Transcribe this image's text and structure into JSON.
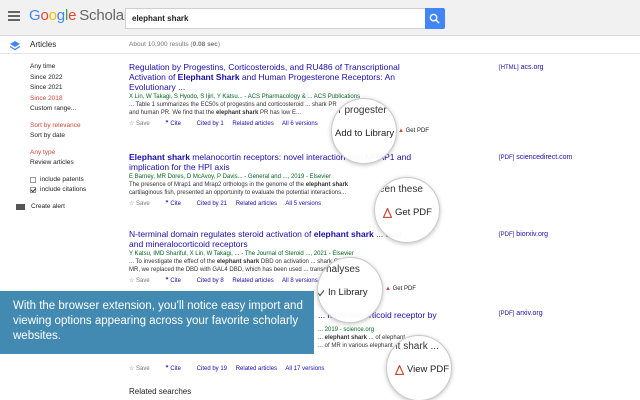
{
  "header": {
    "logo_parts": [
      "G",
      "o",
      "o",
      "g",
      "l",
      "e"
    ],
    "logo_product": "Scholar",
    "search_value": "elephant shark"
  },
  "subbar": {
    "section_label": "Articles",
    "results_prefix": "About 10,900 results (",
    "results_time": "0.08 sec",
    "results_suffix": ")"
  },
  "sidebar": {
    "time_items": [
      "Any time",
      "Since 2022",
      "Since 2021",
      "Since 2018",
      "Custom range..."
    ],
    "sort_items": [
      "Sort by relevance",
      "Sort by date"
    ],
    "type_items": [
      "Any type",
      "Review articles"
    ],
    "include_patents": "include patents",
    "include_citations": "include citations",
    "create_alert": "Create alert"
  },
  "results": [
    {
      "title_lines": [
        "Regulation by Progestins, Corticosteroids, and RU486 of Transcriptional",
        "Activation of Elephant Shark and Human Progesterone Receptors: An",
        "Evolutionary ..."
      ],
      "authors": "X Lin, W Takagi, S Hyodo, S Ijiri, Y Katsu... - ACS Pharmacology & ... ACS Publications",
      "snippet": [
        "... Table 1 summarizes the EC50s of progestins and corticosteroid ... shark PR",
        "and human PR. We find that the elephant shark PR has low E..."
      ],
      "actions": [
        "Save",
        "Cite",
        "Cited by 1",
        "Related articles",
        "All 6 versions"
      ],
      "side_format": "[HTML]",
      "side_source": "acs.org"
    },
    {
      "title_lines": [
        "Elephant shark melanocortin receptors: novel interaction with MRAP1 and",
        "implication for the HPI axis"
      ],
      "authors": "E Barney, MR Dores, D McAvoy, P Davis... - General and ..., 2019 - Elsevier",
      "snippet": [
        "The presence of Mrap1 and Mrap2 orthologs in the genome of the elephant shark",
        "cartilaginous fish, presented an opportunity to evaluate the potential interactions..."
      ],
      "actions": [
        "Save",
        "Cite",
        "Cited by 21",
        "Related articles",
        "All 5 versions"
      ],
      "side_format": "[PDF]",
      "side_source": "sciencedirect.com"
    },
    {
      "title_lines": [
        "N-terminal domain regulates steroid activation of elephant shark ... coid",
        "and mineralocorticoid receptors"
      ],
      "authors": "Y Katsu, IMD Shariful, X Lin, W Takagi, ... - The Journal of Steroid ..., 2021 - Elsevier",
      "snippet": [
        "... To investigate the effect of the elephant shark DBD on activation ... shark GR and",
        "MR, we replaced the DBD with GAL4 DBD, which has been used ... transcriptional ..."
      ],
      "actions": [
        "Save",
        "Cite",
        "Cited by 8",
        "Related articles",
        "All 8 versions"
      ],
      "side_format": "[PDF]",
      "side_source": "biorxiv.org"
    },
    {
      "title_lines": [
        "... mineralocorticoid receptor by",
        "..."
      ],
      "authors": "... 2019 - science.org",
      "snippet": [
        "... elephant shark ... of elephant",
        "... of MR in various elephant ..."
      ],
      "actions": [
        "Save",
        "Cite",
        "Cited by 19",
        "Related articles",
        "All 17 versions"
      ],
      "side_format": "[PDF]",
      "side_source": "arxiv.org"
    }
  ],
  "bubbles": [
    {
      "ghost": "for progester",
      "label": "Add to Library"
    },
    {
      "ghost": "een these",
      "label": "Get PDF"
    },
    {
      "ghost": "nalyses",
      "label": "In Library"
    },
    {
      "ghost": "hant shark ...",
      "label": "View PDF"
    }
  ],
  "small_labels": {
    "get_pdf_1": "Get PDF",
    "get_pdf_3": "Get PDF"
  },
  "overlay_text": "With the browser extension, you'll notice easy import and viewing options appearing across your favorite scholarly websites.",
  "related_searches": "Related searches",
  "colors": {
    "link": "#1a0dab",
    "author_green": "#006621",
    "active_red": "#d14836",
    "search_blue": "#4285f4",
    "overlay_blue": "#3380ad"
  }
}
